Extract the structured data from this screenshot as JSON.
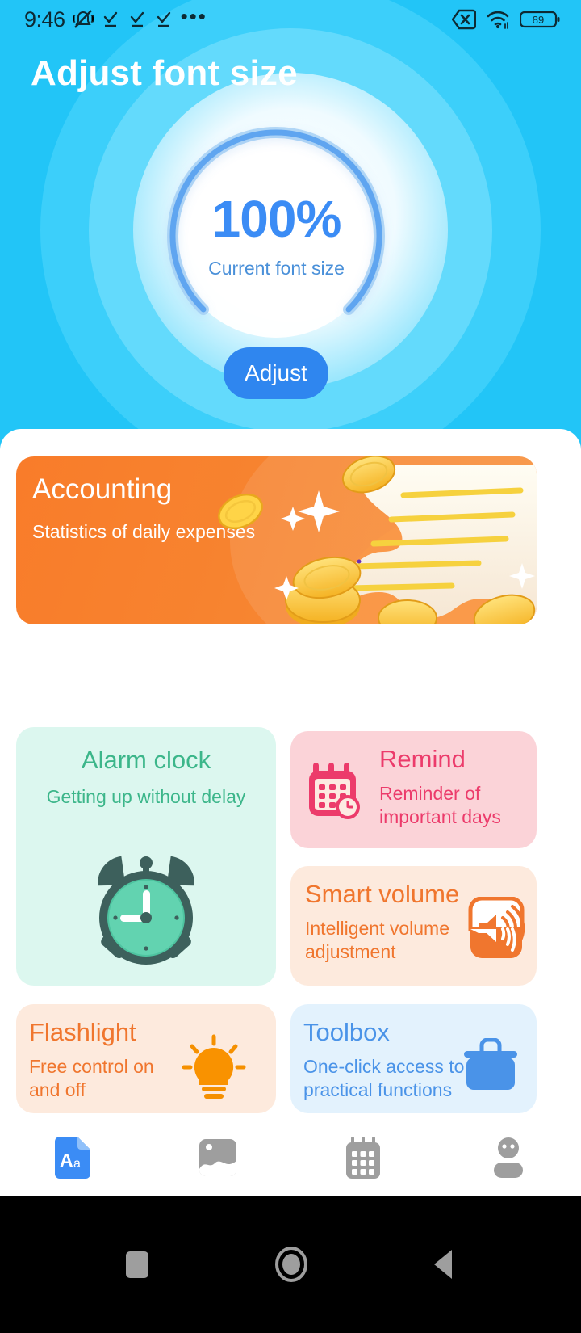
{
  "statusbar": {
    "time": "9:46",
    "battery": "89",
    "icons": [
      "mute-icon",
      "check-icon",
      "check-icon",
      "check-icon",
      "more-dots-icon",
      "sim-x-icon",
      "wifi-icon",
      "battery-icon"
    ]
  },
  "header": {
    "title": "Adjust font size",
    "gauge": {
      "value": "100%",
      "label": "Current font size",
      "percent": 100,
      "value_color": "#3b8cf5",
      "track_color": "#b9dcfb",
      "progress_color": "#5fa5f0"
    },
    "adjust_button": "Adjust",
    "bg_color": "#22c5f7"
  },
  "banner": {
    "title": "Accounting",
    "subtitle": "Statistics of daily expenses",
    "accent": "#f97c2a",
    "art": "coins-receipt-illustration"
  },
  "cards": [
    {
      "id": "alarm",
      "title": "Alarm clock",
      "subtitle": "Getting up without delay",
      "bg": "#dcf7ef",
      "fg": "#3cb68a",
      "art": "alarm-clock-icon"
    },
    {
      "id": "remind",
      "title": "Remind",
      "subtitle": "Reminder of important days",
      "bg": "#fbd3d8",
      "fg": "#ec3b6b",
      "art": "calendar-clock-icon"
    },
    {
      "id": "volume",
      "title": "Smart volume",
      "subtitle": "Intelligent volume adjustment",
      "bg": "#fdeadd",
      "fg": "#f0762e",
      "art": "speaker-icon"
    },
    {
      "id": "flashlight",
      "title": "Flashlight",
      "subtitle": "Free control on and off",
      "bg": "#fdeadd",
      "fg": "#f0762e",
      "art": "lightbulb-icon"
    },
    {
      "id": "toolbox",
      "title": "Toolbox",
      "subtitle": "One-click access to practical functions",
      "bg": "#e3f2fd",
      "fg": "#4a93e8",
      "art": "briefcase-icon"
    }
  ],
  "tabbar": {
    "items": [
      {
        "icon": "font-document-icon",
        "active": true,
        "color": "#3b8cf5"
      },
      {
        "icon": "image-photo-icon",
        "active": false,
        "color": "#9e9e9e"
      },
      {
        "icon": "calendar-grid-icon",
        "active": false,
        "color": "#9e9e9e"
      },
      {
        "icon": "person-icon",
        "active": false,
        "color": "#9e9e9e"
      }
    ]
  },
  "navbar": {
    "buttons": [
      "recents-square-icon",
      "home-circle-icon",
      "back-triangle-icon"
    ],
    "color": "#9e9e9e"
  }
}
